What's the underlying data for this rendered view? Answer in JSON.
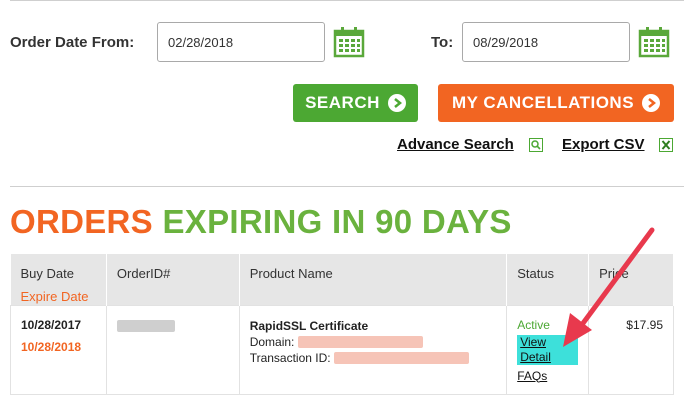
{
  "filters": {
    "from_label": "Order Date From:",
    "from_value": "02/28/2018",
    "to_label": "To:",
    "to_value": "08/29/2018"
  },
  "buttons": {
    "search": "SEARCH",
    "cancellations": "MY CANCELLATIONS"
  },
  "links": {
    "advance_search": "Advance Search",
    "export_csv": "Export CSV"
  },
  "heading": {
    "part1": "ORDERS",
    "part2": "EXPIRING IN 90 DAYS"
  },
  "table": {
    "headers": {
      "buy_date": "Buy Date",
      "expire_date": "Expire Date",
      "order_id": "OrderID#",
      "product_name": "Product Name",
      "status": "Status",
      "price": "Price"
    },
    "rows": [
      {
        "buy_date": "10/28/2017",
        "expire_date": "10/28/2018",
        "product": "RapidSSL Certificate",
        "domain_label": "Domain:",
        "transaction_label": "Transaction ID:",
        "status": "Active",
        "view_detail": "View Detail",
        "faqs": "FAQs",
        "price": "$17.95"
      }
    ]
  },
  "colors": {
    "accent_orange": "#f26522",
    "accent_green": "#4ca833",
    "highlight_cyan": "#3de0da",
    "annotation_arrow": "#e8394d"
  },
  "icons": [
    "calendar-icon",
    "arrow-right-icon",
    "search-icon",
    "excel-icon"
  ]
}
